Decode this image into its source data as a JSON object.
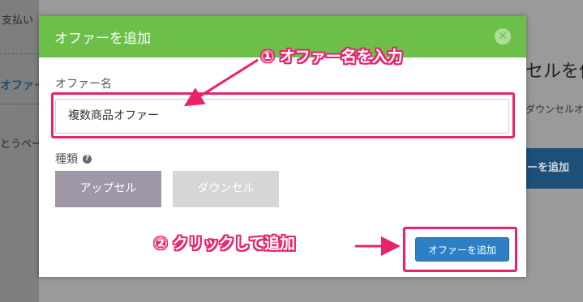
{
  "background": {
    "sidebar_item_1": "支払い",
    "sidebar_item_2": "オファー",
    "sidebar_item_3": "とうペー",
    "heading": "セルを作",
    "sub_text": "ダウンセルオフ",
    "add_button": "ーを追加"
  },
  "modal": {
    "title": "オファーを追加",
    "name_label": "オファー名",
    "name_value": "複数商品オファー",
    "type_label": "種類",
    "type_options": [
      "アップセル",
      "ダウンセル"
    ],
    "selected_type": "アップセル",
    "submit_label": "オファーを追加"
  },
  "annotations": {
    "step1": "① オファー名を入力",
    "step2": "② クリックして追加",
    "color": "#e8236b"
  },
  "colors": {
    "header": "#6cc04a",
    "primary_button": "#2e80c6",
    "selected_type": "#9f97a7",
    "unselected_type": "#d6d6d6"
  }
}
